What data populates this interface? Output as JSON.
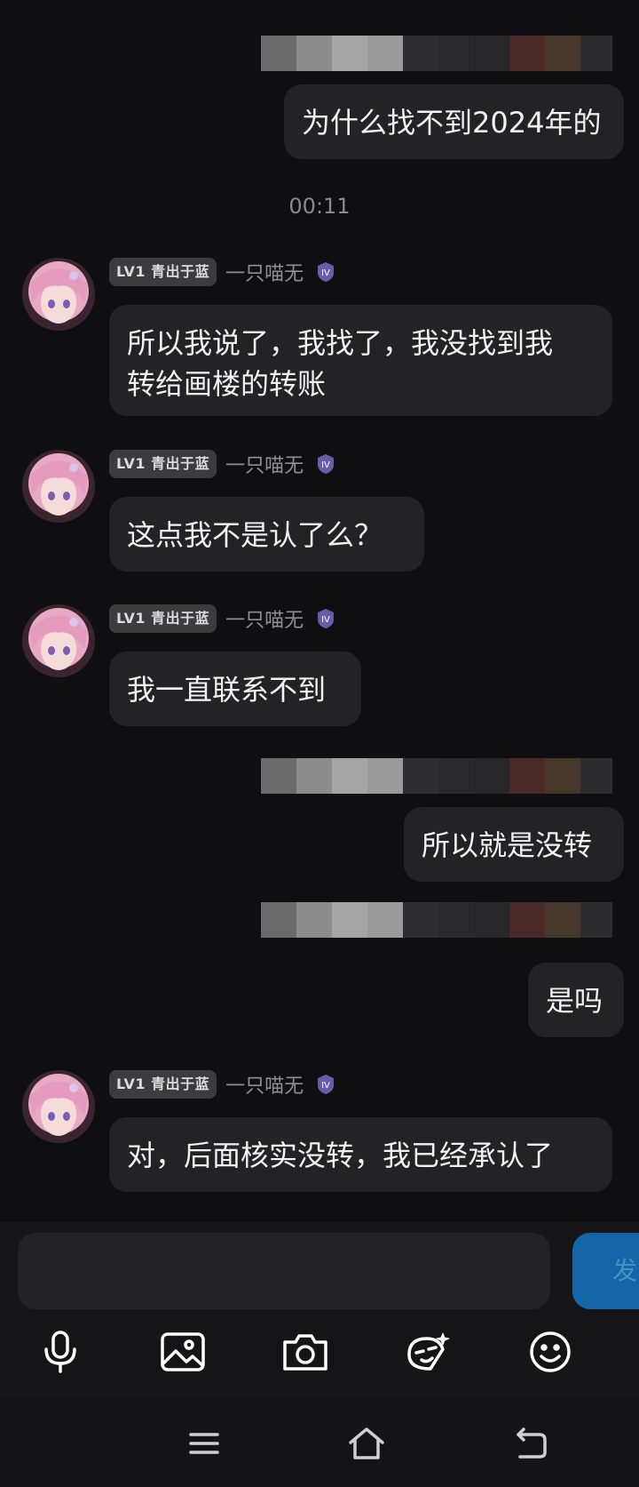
{
  "messages": [
    {
      "side": "right",
      "text": "为什么找不到2024年的"
    },
    {
      "side": "left",
      "badge": "LV1 青出于蓝",
      "nick": "一只喵无",
      "text": "所以我说了，我找了，我没找到我\n转给画楼的转账"
    },
    {
      "side": "left",
      "badge": "LV1 青出于蓝",
      "nick": "一只喵无",
      "text": "这点我不是认了么？"
    },
    {
      "side": "left",
      "badge": "LV1 青出于蓝",
      "nick": "一只喵无",
      "text": "我一直联系不到"
    },
    {
      "side": "right",
      "text": "所以就是没转"
    },
    {
      "side": "right",
      "text": "是吗"
    },
    {
      "side": "left",
      "badge": "LV1 青出于蓝",
      "nick": "一只喵无",
      "text": "对，后面核实没转，我已经承认了"
    }
  ],
  "timestamp": "00:11",
  "input": {
    "send_label": "发"
  },
  "toolbar": [
    "microphone-icon",
    "image-icon",
    "camera-icon",
    "sticker-icon",
    "emoji-icon"
  ],
  "navbar": [
    "menu-icon",
    "home-icon",
    "back-icon"
  ],
  "colors": {
    "background": "#0f0f11",
    "bubble": "#232326",
    "accent": "#1466a8",
    "badge": "#3b3b40"
  }
}
